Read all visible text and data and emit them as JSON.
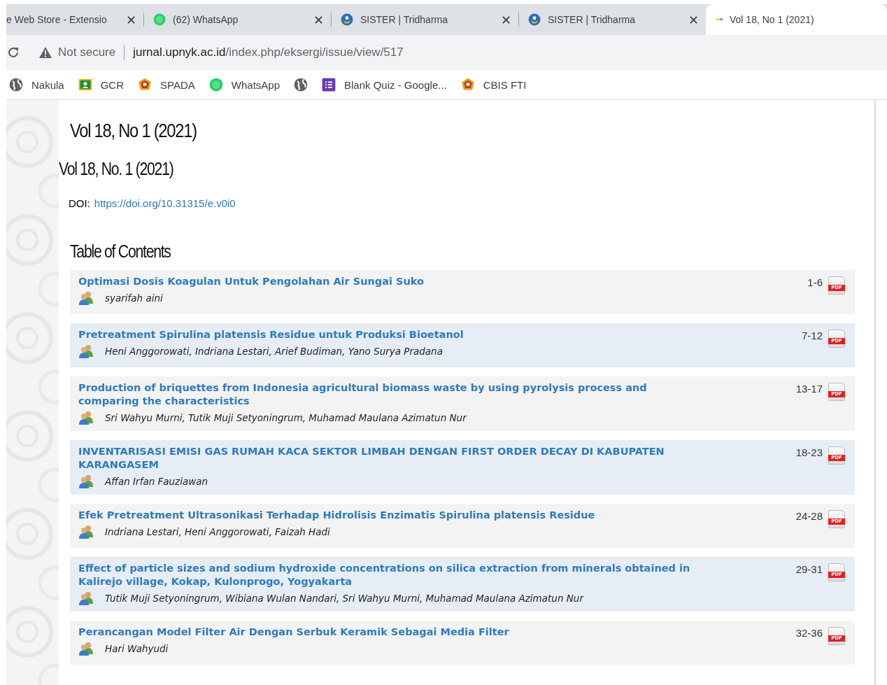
{
  "browser": {
    "tabs": [
      {
        "title": "e Web Store - Extensio",
        "kind": "plain",
        "selected": false
      },
      {
        "title": "(62) WhatsApp",
        "kind": "chat",
        "selected": false
      },
      {
        "title": "SISTER | Tridharma",
        "kind": "emblem",
        "selected": false
      },
      {
        "title": "SISTER | Tridharma",
        "kind": "emblem",
        "selected": false
      },
      {
        "title": "Vol 18, No 1 (2021)",
        "kind": "small",
        "selected": true
      }
    ],
    "security": "Not secure",
    "url_host": "jurnal.upnyk.ac.id",
    "url_path": "/index.php/eksergi/issue/view/517",
    "bookmarks": [
      {
        "label": "Nakula",
        "kind": "globe"
      },
      {
        "label": "GCR",
        "kind": "board"
      },
      {
        "label": "SPADA",
        "kind": "crest"
      },
      {
        "label": "WhatsApp",
        "kind": "chat"
      },
      {
        "kind": "globe"
      },
      {
        "label": "Blank Quiz - Google...",
        "kind": "list"
      },
      {
        "label": "CBIS FTI",
        "kind": "crest"
      }
    ]
  },
  "page": {
    "title": "Vol 18, No 1 (2021)",
    "issue_title": "Vol 18, No. 1 (2021)",
    "doi_label": "DOI:",
    "doi": "https://doi.org/10.31315/e.v0i0",
    "toc_heading": "Table of Contents",
    "articles": [
      {
        "title": "Optimasi Dosis Koagulan Untuk Pengolahan Air Sungai Suko",
        "authors": "syarifah aini",
        "pages": "1-6",
        "galley": "PDF"
      },
      {
        "title": "Pretreatment Spirulina platensis Residue untuk Produksi Bioetanol",
        "authors": "Heni Anggorowati, Indriana Lestari, Arief Budiman, Yano Surya Pradana",
        "pages": "7-12",
        "galley": "PDF"
      },
      {
        "title": "Production of briquettes from Indonesia agricultural biomass waste by using pyrolysis process and comparing the characteristics",
        "authors": "Sri Wahyu Murni, Tutik Muji Setyoningrum, Muhamad Maulana Azimatun Nur",
        "pages": "13-17",
        "galley": "PDF"
      },
      {
        "title": "INVENTARISASI EMISI GAS RUMAH KACA SEKTOR LIMBAH DENGAN FIRST ORDER DECAY DI KABUPATEN KARANGASEM",
        "authors": "Affan Irfan Fauziawan",
        "pages": "18-23",
        "galley": "PDF"
      },
      {
        "title": "Efek Pretreatment Ultrasonikasi Terhadap Hidrolisis Enzimatis Spirulina platensis Residue",
        "authors": "Indriana Lestari, Heni Anggorowati, Faizah Hadi",
        "pages": "24-28",
        "galley": "PDF"
      },
      {
        "title": "Effect of particle sizes and sodium hydroxide concentrations on silica extraction from minerals obtained in Kalirejo village, Kokap, Kulonprogo, Yogyakarta",
        "authors": "Tutik Muji Setyoningrum, Wibiana Wulan Nandari, Sri Wahyu Murni, Muhamad Maulana Azimatun Nur",
        "pages": "29-31",
        "galley": "PDF"
      },
      {
        "title": "Perancangan Model Filter Air Dengan Serbuk Keramik Sebagai Media Filter",
        "authors": "Hari Wahyudi",
        "pages": "32-36",
        "galley": "PDF"
      }
    ]
  }
}
